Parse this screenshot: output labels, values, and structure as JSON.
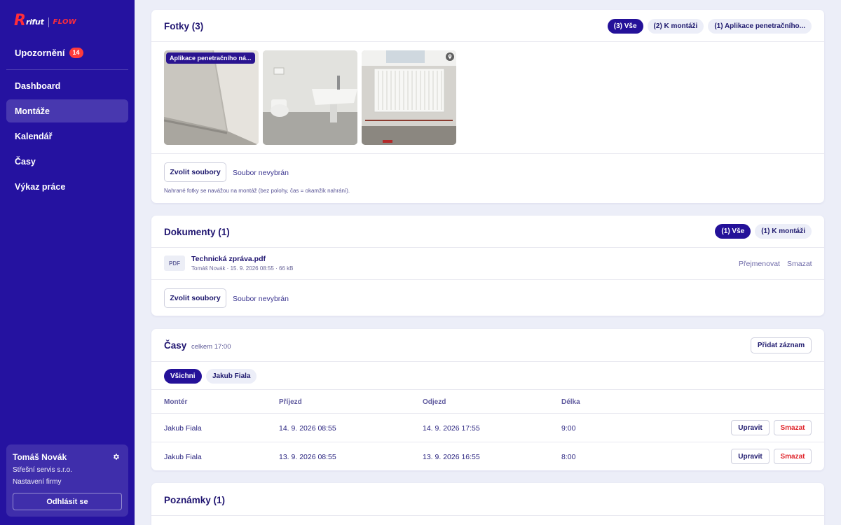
{
  "brand": {
    "r": "R",
    "rifut": "rifut",
    "flow": "FLOW"
  },
  "sidebar": {
    "notifications": {
      "label": "Upozornění",
      "count": "14"
    },
    "items": [
      {
        "label": "Dashboard",
        "active": false
      },
      {
        "label": "Montáže",
        "active": true
      },
      {
        "label": "Kalendář",
        "active": false
      },
      {
        "label": "Časy",
        "active": false
      },
      {
        "label": "Výkaz práce",
        "active": false
      }
    ],
    "user": {
      "name": "Tomáš Novák",
      "company": "Střešní servis s.r.o.",
      "settings_link": "Nastavení firmy",
      "logout": "Odhlásit se"
    }
  },
  "photos_card": {
    "title": "Fotky (3)",
    "filters": [
      "(3) Vše",
      "(2) K montáži",
      "(1) Aplikace penetračního..."
    ],
    "active_filter": 0,
    "photos": [
      {
        "label": "Aplikace penetračního ná...",
        "icon": "image"
      },
      {
        "label": "",
        "icon": "image"
      },
      {
        "label": "",
        "icon": "map-pin-icon"
      }
    ],
    "choose_button": "Zvolit soubory",
    "no_file": "Soubor nevybrán",
    "note": "Nahrané fotky se navážou na montáž (bez polohy, čas = okamžik nahrání)."
  },
  "documents_card": {
    "title": "Dokumenty (1)",
    "filters": [
      "(1) Vše",
      "(1) K montáži"
    ],
    "active_filter": 0,
    "files": [
      {
        "type": "PDF",
        "name": "Technická zpráva.pdf",
        "meta": "Tomáš Novák · 15. 9. 2026 08:55 · 66 kB",
        "rename": "Přejmenovat",
        "delete": "Smazat"
      }
    ],
    "choose_button": "Zvolit soubory",
    "no_file": "Soubor nevybrán"
  },
  "times_card": {
    "title": "Časy",
    "total": "celkem 17:00",
    "add_button": "Přidat záznam",
    "filters": [
      "Všichni",
      "Jakub Fiala"
    ],
    "active_filter": 0,
    "columns": [
      "Montér",
      "Příjezd",
      "Odjezd",
      "Délka"
    ],
    "rows": [
      {
        "worker": "Jakub Fiala",
        "arrival": "14. 9. 2026 08:55",
        "departure": "14. 9. 2026 17:55",
        "duration": "9:00",
        "edit": "Upravit",
        "delete": "Smazat"
      },
      {
        "worker": "Jakub Fiala",
        "arrival": "13. 9. 2026 08:55",
        "departure": "13. 9. 2026 16:55",
        "duration": "8:00",
        "edit": "Upravit",
        "delete": "Smazat"
      }
    ]
  },
  "notes_card": {
    "title": "Poznámky (1)"
  },
  "colors": {
    "sidebar": "#2512a0",
    "accent": "#241199",
    "danger": "#e0282e",
    "background": "#eceef8"
  }
}
